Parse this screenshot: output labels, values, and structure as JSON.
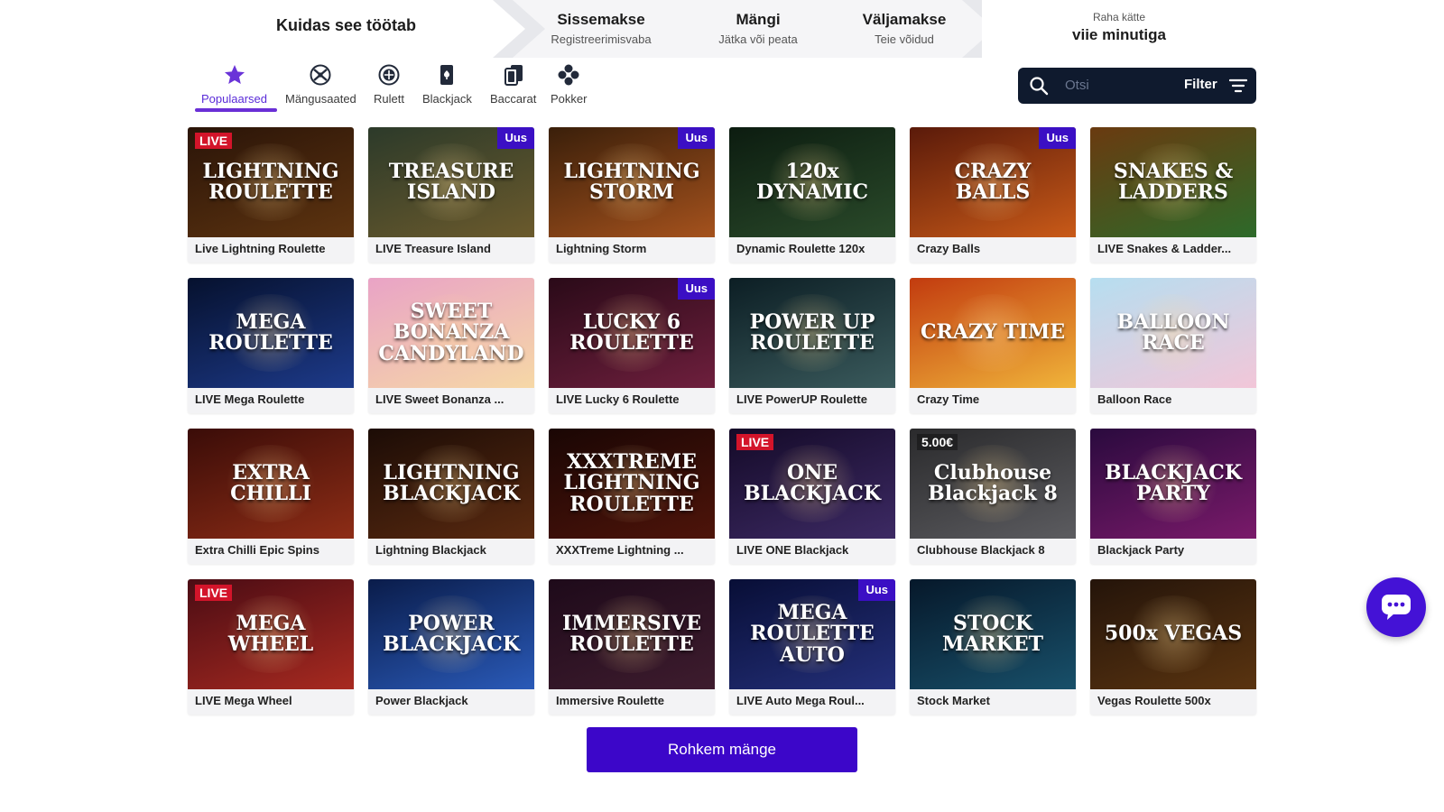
{
  "steps": {
    "how_it_works": "Kuidas see töötab",
    "deposit": {
      "title": "Sissemakse",
      "sub": "Registreerimisvaba"
    },
    "play": {
      "title": "Mängi",
      "sub": "Jätka või peata"
    },
    "withdraw": {
      "title": "Väljamakse",
      "sub": "Teie võidud"
    },
    "payout": {
      "sub": "Raha kätte",
      "title": "viie minutiga"
    }
  },
  "categories": [
    {
      "label": "Populaarsed",
      "icon": "star-icon",
      "active": true
    },
    {
      "label": "Mängusaated",
      "icon": "game-show-icon",
      "active": false
    },
    {
      "label": "Rulett",
      "icon": "roulette-icon",
      "active": false
    },
    {
      "label": "Blackjack",
      "icon": "blackjack-icon",
      "active": false
    },
    {
      "label": "Baccarat",
      "icon": "baccarat-icon",
      "active": false
    },
    {
      "label": "Pokker",
      "icon": "poker-icon",
      "active": false
    }
  ],
  "search": {
    "placeholder": "Otsi",
    "filter_label": "Filter"
  },
  "badge_label": "Uus",
  "games": [
    {
      "name": "Live Lightning Roulette",
      "logo": "LIGHTNING ROULETTE",
      "tag": "LIVE",
      "new": false,
      "bg": [
        "#2a1408",
        "#5e3410"
      ]
    },
    {
      "name": "LIVE Treasure Island",
      "logo": "TREASURE ISLAND",
      "tag": "",
      "new": true,
      "bg": [
        "#2c3a2a",
        "#6b5a2c"
      ]
    },
    {
      "name": "Lightning Storm",
      "logo": "LIGHTNING STORM",
      "tag": "",
      "new": true,
      "bg": [
        "#3a1f0a",
        "#a5521d"
      ]
    },
    {
      "name": "Dynamic Roulette 120x",
      "logo": "120x DYNAMIC",
      "tag": "",
      "new": false,
      "bg": [
        "#0c1c10",
        "#2a4a2a"
      ]
    },
    {
      "name": "Crazy Balls",
      "logo": "CRAZY BALLS",
      "tag": "",
      "new": true,
      "bg": [
        "#5a1a0a",
        "#c95a18"
      ]
    },
    {
      "name": "LIVE Snakes & Ladder...",
      "logo": "SNAKES & LADDERS",
      "tag": "",
      "new": false,
      "bg": [
        "#6a3a10",
        "#2d6a2a"
      ]
    },
    {
      "name": "LIVE Mega Roulette",
      "logo": "MEGA ROULETTE",
      "tag": "",
      "new": false,
      "bg": [
        "#06112e",
        "#1d3a8a"
      ]
    },
    {
      "name": "LIVE Sweet Bonanza ...",
      "logo": "SWEET BONANZA CANDYLAND",
      "tag": "",
      "new": false,
      "bg": [
        "#e9a3c6",
        "#f6d8a6"
      ]
    },
    {
      "name": "LIVE Lucky 6 Roulette",
      "logo": "LUCKY 6 ROULETTE",
      "tag": "",
      "new": true,
      "bg": [
        "#2a0a18",
        "#6e1f3d"
      ]
    },
    {
      "name": "LIVE PowerUP Roulette",
      "logo": "POWER UP ROULETTE",
      "tag": "",
      "new": false,
      "bg": [
        "#0c1e24",
        "#3a5a5c"
      ]
    },
    {
      "name": "Crazy Time",
      "logo": "CRAZY TIME",
      "tag": "",
      "new": false,
      "bg": [
        "#c23b0f",
        "#f0b43a"
      ]
    },
    {
      "name": "Balloon Race",
      "logo": "BALLOON RACE",
      "tag": "",
      "new": false,
      "bg": [
        "#b6def0",
        "#f2c6d8"
      ]
    },
    {
      "name": "Extra Chilli Epic Spins",
      "logo": "EXTRA CHILLI",
      "tag": "",
      "new": false,
      "bg": [
        "#3a0c08",
        "#8e2d16"
      ]
    },
    {
      "name": "Lightning Blackjack",
      "logo": "LIGHTNING BLACKJACK",
      "tag": "",
      "new": false,
      "bg": [
        "#1c0c06",
        "#5a2a10"
      ]
    },
    {
      "name": "XXXTreme Lightning ...",
      "logo": "XXXTREME LIGHTNING ROULETTE",
      "tag": "",
      "new": false,
      "bg": [
        "#1a0604",
        "#4e140a"
      ]
    },
    {
      "name": "LIVE ONE Blackjack",
      "logo": "ONE BLACKJACK",
      "tag": "LIVE",
      "new": false,
      "bg": [
        "#140a28",
        "#3d2a64"
      ]
    },
    {
      "name": "Clubhouse Blackjack 8",
      "logo": "Clubhouse Blackjack 8",
      "tag": "5.00€",
      "new": false,
      "bg": [
        "#2a2a2c",
        "#5c5c60"
      ]
    },
    {
      "name": "Blackjack Party",
      "logo": "BLACKJACK PARTY",
      "tag": "",
      "new": false,
      "bg": [
        "#2a0a3e",
        "#7a1a6a"
      ]
    },
    {
      "name": "LIVE Mega Wheel",
      "logo": "MEGA WHEEL",
      "tag": "LIVE",
      "new": false,
      "bg": [
        "#4a0c14",
        "#a82a20"
      ]
    },
    {
      "name": "Power Blackjack",
      "logo": "POWER BLACKJACK",
      "tag": "",
      "new": false,
      "bg": [
        "#0a1c4a",
        "#2a5ab8"
      ]
    },
    {
      "name": "Immersive Roulette",
      "logo": "IMMERSIVE ROULETTE",
      "tag": "",
      "new": false,
      "bg": [
        "#1e0a1a",
        "#3e1c2e"
      ]
    },
    {
      "name": "LIVE Auto Mega Roul...",
      "logo": "MEGA ROULETTE AUTO",
      "tag": "",
      "new": true,
      "bg": [
        "#080e36",
        "#24307a"
      ]
    },
    {
      "name": "Stock Market",
      "logo": "STOCK MARKET",
      "tag": "",
      "new": false,
      "bg": [
        "#06182a",
        "#18506a"
      ]
    },
    {
      "name": "Vegas Roulette 500x",
      "logo": "500x VEGAS",
      "tag": "",
      "new": false,
      "bg": [
        "#24140a",
        "#5a3410"
      ]
    }
  ],
  "more_button": "Rohkem mänge",
  "colors": {
    "accent": "#4412d6",
    "badge": "#3b0fc4",
    "search_bg": "#0f1a2e"
  }
}
